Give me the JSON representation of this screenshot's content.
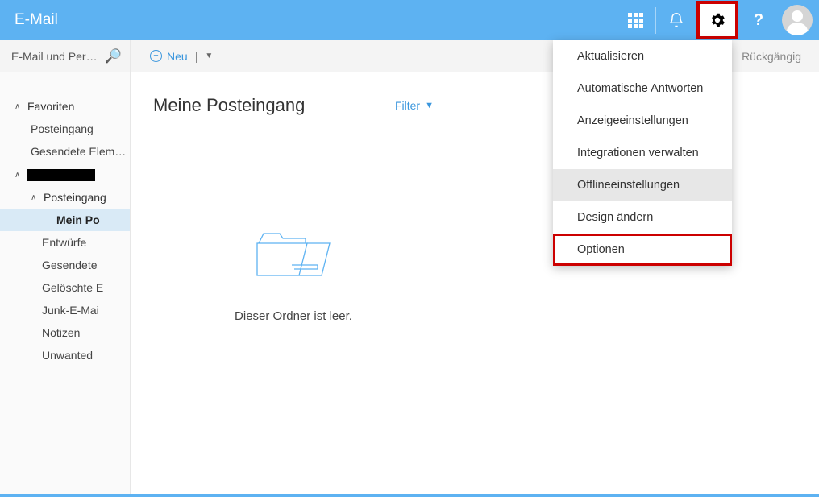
{
  "header": {
    "title": "E-Mail"
  },
  "search": {
    "placeholder": "E-Mail und Perso..."
  },
  "actions": {
    "new_label": "Neu",
    "undo_label": "Rückgängig"
  },
  "sidebar": {
    "fav_label": "Favoriten",
    "fav_items": [
      "Posteingang",
      "Gesendete Elemente"
    ],
    "account_label": "",
    "inbox_label": "Posteingang",
    "folders": [
      "Mein Posteingang",
      "Entwürfe",
      "Gesendete",
      "Gelöschte Elemente",
      "Junk-E-Mail",
      "Notizen",
      "Unwanted"
    ]
  },
  "middle": {
    "title": "Meine Posteingang",
    "filter_label": "Filter",
    "empty_text": "Dieser Ordner ist leer."
  },
  "settings_menu": {
    "items": [
      "Aktualisieren",
      "Automatische Antworten",
      "Anzeigeeinstellungen",
      "Integrationen verwalten",
      "Offlineeinstellungen",
      "Design ändern",
      "Optionen"
    ]
  }
}
